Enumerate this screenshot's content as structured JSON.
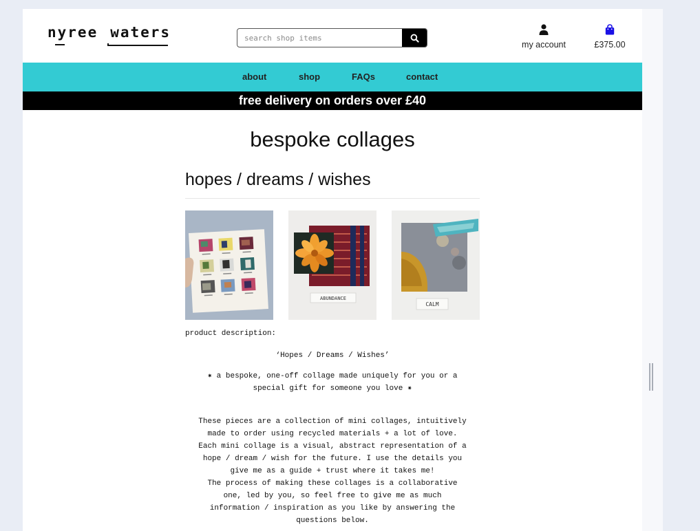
{
  "brand": {
    "word1": "nyree",
    "word2": "waters"
  },
  "search": {
    "placeholder": "search shop items"
  },
  "account": {
    "label": "my account"
  },
  "cart": {
    "total": "£375.00"
  },
  "nav": {
    "items": [
      "about",
      "shop",
      "FAQs",
      "contact"
    ]
  },
  "banner": {
    "text": "free delivery on orders over £40"
  },
  "page": {
    "title": "bespoke collages"
  },
  "product": {
    "name": "hopes / dreams / wishes",
    "images": [
      {
        "alt": "mini collages grid"
      },
      {
        "alt": "abundance collage",
        "label": "ABUNDANCE"
      },
      {
        "alt": "calm collage",
        "label": "CALM"
      }
    ],
    "description_label": "product description:",
    "quote_title": "‘Hopes / Dreams / Wishes’",
    "tagline_1": "✷ a bespoke, one-off collage made uniquely for you or a",
    "tagline_2": "special gift for someone you love ✷",
    "para": [
      "These pieces are a collection of mini collages, intuitively",
      "made to order using recycled materials + a lot of love.",
      "Each mini collage is a visual, abstract representation of a",
      "hope / dream / wish for the future. I use the details you",
      "give me as a guide + trust where it takes me!",
      "The process of making these collages is a collaborative",
      "one, led by you, so feel free to give me as much",
      "information / inspiration as you like by answering the",
      "questions below."
    ]
  },
  "colors": {
    "nav_bg": "#33cbd3",
    "banner_bg": "#000000",
    "cart_icon": "#1a10e6"
  }
}
